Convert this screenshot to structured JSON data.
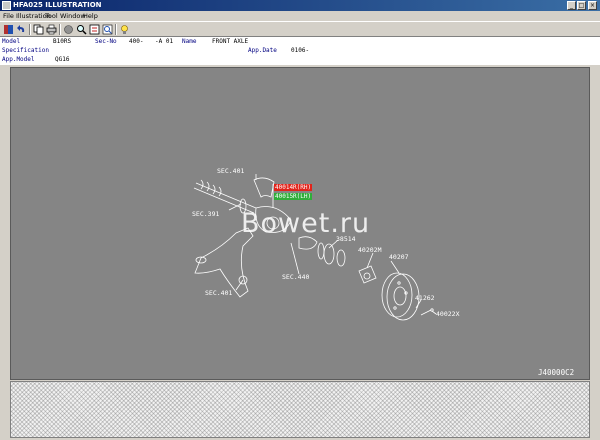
{
  "window": {
    "title": "HFA025 ILLUSTRATION"
  },
  "menu": {
    "file": "File",
    "illustration": "Illustration",
    "tool": "Tool",
    "window": "Window",
    "help": "Help"
  },
  "toolbar": {
    "icons": [
      "book-icon",
      "undo-icon",
      "copy-icon",
      "print-icon",
      "circle-icon",
      "magnifier-icon",
      "list-icon",
      "zoom-icon",
      "bulb-icon"
    ]
  },
  "info": {
    "model_label": "Model",
    "model_value": "B10RS",
    "secno_label": "Sec-No",
    "secno_value": "400-",
    "secno_value2": "-A 01",
    "name_label": "Name",
    "name_value": "FRONT AXLE",
    "spec_label": "Specification",
    "appdate_label": "App.Date",
    "appdate_value": "0106-",
    "appmodel_label": "App.Model",
    "appmodel_value": "QG16"
  },
  "illustration": {
    "labels": {
      "sec401_top": "SEC.401",
      "sec391": "SEC.391",
      "sec401_bottom": "SEC.401",
      "sec440": "SEC.440",
      "p38514": "38514",
      "p40202m": "40202M",
      "p40207": "40207",
      "p41262": "41262",
      "p40022x": "40022X",
      "code": "J40000C2"
    },
    "highlight_red": "40014R(RH)",
    "highlight_green": "40015R(LH)",
    "watermark": "Bowet.ru"
  }
}
